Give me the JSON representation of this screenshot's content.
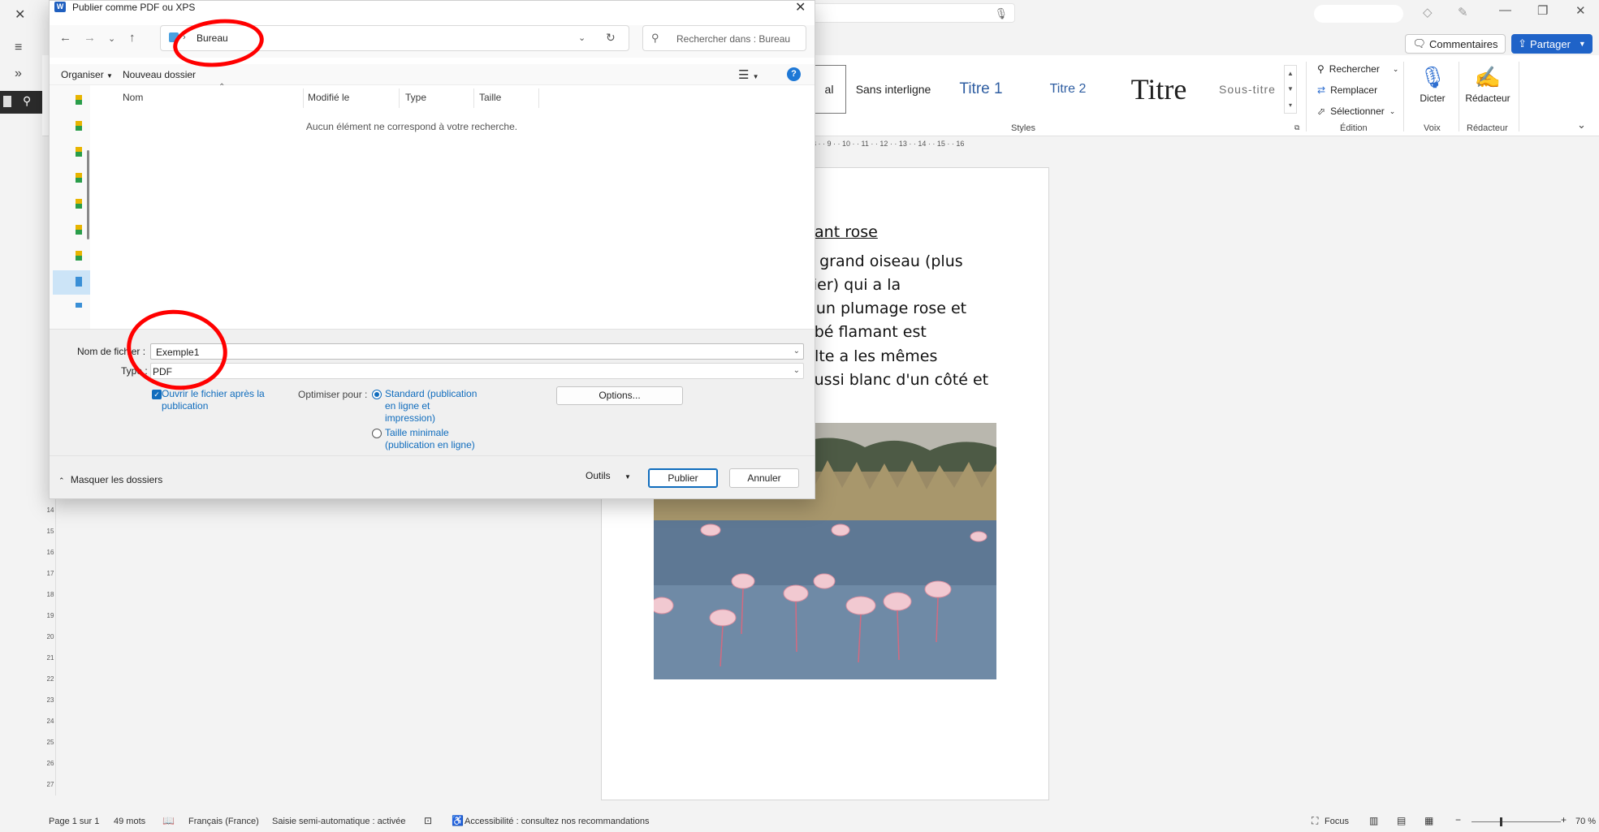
{
  "word": {
    "ribbon": {
      "comments_label": "Commentaires",
      "share_label": "Partager",
      "styles": {
        "normal": "al",
        "no_spacing": "Sans interligne",
        "heading1": "Titre 1",
        "heading2": "Titre 2",
        "title": "Titre",
        "subtitle": "Sous-titre",
        "group_label": "Styles"
      },
      "editing": {
        "find": "Rechercher",
        "replace": "Remplacer",
        "select": "Sélectionner",
        "group_label": "Édition"
      },
      "dictate": {
        "label": "Dicter",
        "group_label": "Voix"
      },
      "editor": {
        "label": "Rédacteur",
        "group_label": "Rédacteur"
      }
    },
    "ruler": {
      "horizontal": "8 · · 9 · · 10 · · 11 · · 12 · · 13 · · 14 · · 15 · · 16",
      "vertical": [
        "14",
        "15",
        "16",
        "17",
        "18",
        "19",
        "20",
        "21",
        "22",
        "23",
        "24",
        "25",
        "26",
        "27"
      ]
    },
    "document": {
      "lines": [
        "nant rose",
        "n grand oiseau (plus",
        "sier) qui a la",
        "r un plumage rose et",
        "ébé flamant est",
        "ulte a les mêmes",
        "aussi blanc d'un côté et"
      ]
    },
    "status": {
      "page": "Page 1 sur 1",
      "words": "49 mots",
      "language": "Français (France)",
      "autocomplete": "Saisie semi-automatique : activée",
      "accessibility": "Accessibilité : consultez nos recommandations",
      "focus": "Focus",
      "zoom": "70 %"
    }
  },
  "dialog": {
    "title": "Publier comme PDF ou XPS",
    "address": {
      "folder": "Bureau"
    },
    "search": {
      "placeholder": "Rechercher dans : Bureau"
    },
    "toolbar": {
      "organize": "Organiser",
      "new_folder": "Nouveau dossier"
    },
    "columns": [
      "Nom",
      "Modifié le",
      "Type",
      "Taille"
    ],
    "empty_message": "Aucun élément ne correspond à votre recherche.",
    "form": {
      "filename_label": "Nom de fichier :",
      "filename_value": "Exemple1",
      "type_label": "Type :",
      "type_value": "PDF",
      "open_after_line1": "Ouvrir le fichier après la",
      "open_after_line2": "publication",
      "optimize_label": "Optimiser pour :",
      "standard_line1": "Standard (publication",
      "standard_line2": "en ligne et",
      "standard_line3": "impression)",
      "minimal_line1": "Taille minimale",
      "minimal_line2": "(publication en ligne)",
      "options_button": "Options..."
    },
    "footer": {
      "hide_folders": "Masquer les dossiers",
      "tools": "Outils",
      "publish": "Publier",
      "cancel": "Annuler"
    }
  },
  "colors": {
    "accent": "#0f6cbd",
    "share_button": "#1f63c8",
    "annotation": "#ff0000"
  }
}
